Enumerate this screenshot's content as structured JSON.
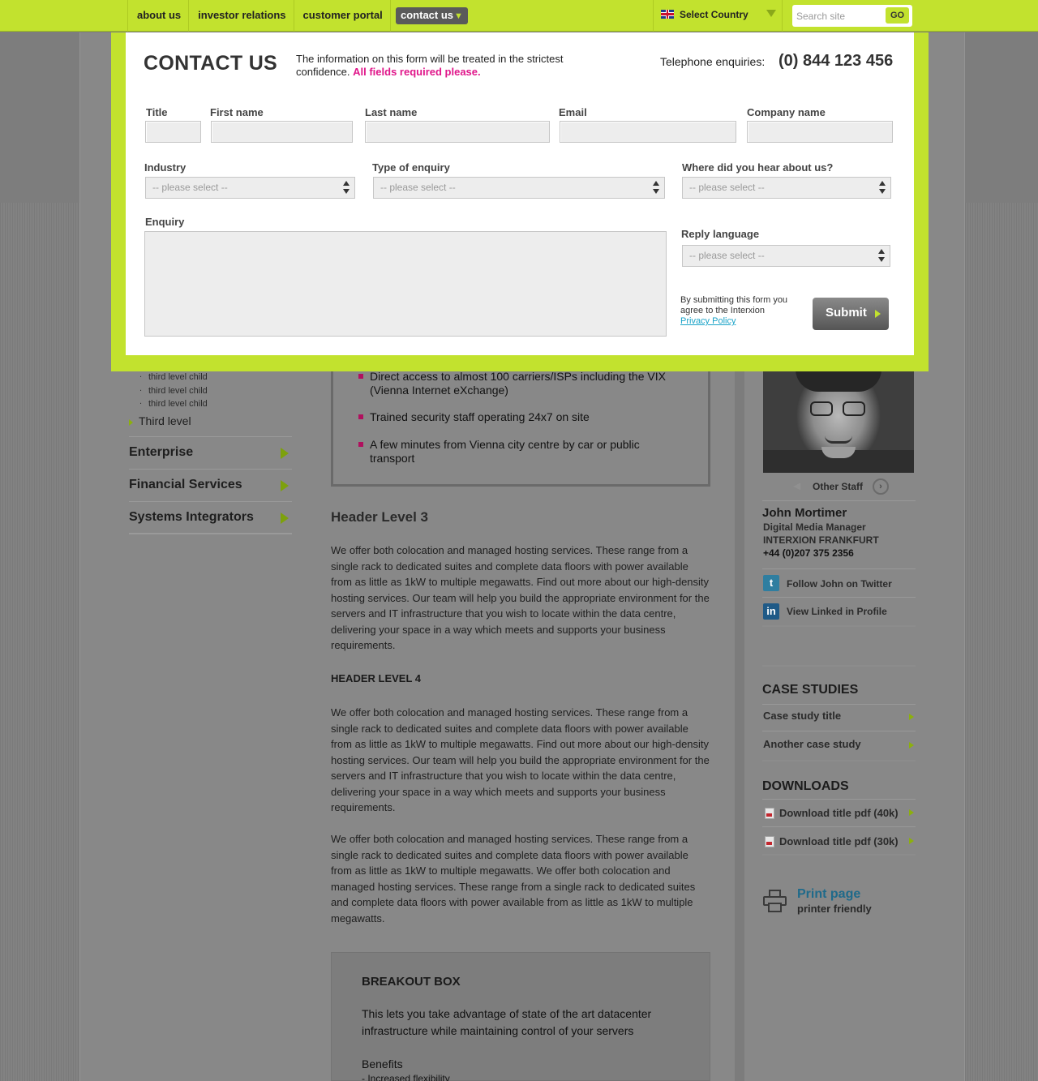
{
  "top_nav": {
    "items": [
      "about us",
      "investor relations",
      "customer portal"
    ],
    "contact": "contact us",
    "country": "Select Country",
    "search_placeholder": "Search site",
    "go": "GO"
  },
  "modal": {
    "title": "CONTACT US",
    "intro": "The information on this form will be treated in the strictest confidence.",
    "required": "All fields required please.",
    "tel_label": "Telephone enquiries:",
    "tel_number": "(0) 844 123 456",
    "fields": {
      "title": "Title",
      "first_name": "First name",
      "last_name": "Last name",
      "email": "Email",
      "company": "Company name",
      "industry": "Industry",
      "enquiry_type": "Type of enquiry",
      "heard": "Where did you hear about us?",
      "enquiry": "Enquiry",
      "reply_language": "Reply language"
    },
    "select_placeholder": "-- please select --",
    "agree_text": "By submitting this form you agree to the Interxion",
    "privacy_link": "Privacy Policy",
    "submit": "Submit"
  },
  "left_nav": {
    "children": [
      "third level child",
      "third level child",
      "third level child"
    ],
    "third_level": "Third level",
    "items": [
      "Enterprise",
      "Financial Services",
      "Systems Integrators"
    ]
  },
  "bullets": [
    "Direct access to almost 100 carriers/ISPs including the VIX (Vienna Internet eXchange)",
    "Trained security staff operating 24x7 on site",
    "A few minutes from Vienna city centre by car or public transport"
  ],
  "content": {
    "h3": "Header Level 3",
    "p1": "We offer both colocation and managed hosting services. These range from a single rack to dedicated suites and complete data floors with power available from as little as 1kW to multiple megawatts. Find out more about our high-density hosting services. Our team will help you build the appropriate environment for the servers and IT infrastructure that you wish to locate within the data centre, delivering your space in a way which meets and supports your business requirements.",
    "h4": "HEADER LEVEL 4",
    "p2": "We offer both colocation and managed hosting services. These range from a single rack to dedicated suites and complete data floors with power available from as little as 1kW to multiple megawatts. Find out more about our high-density hosting services. Our team will help you build the appropriate environment for the servers and IT infrastructure that you wish to locate within the data centre, delivering your space in a way which meets and supports your business requirements.",
    "p3": "We offer both colocation and managed hosting services. These range from a single rack to dedicated suites and complete data floors with power available from as little as 1kW to multiple megawatts. We offer both colocation and managed hosting services. These range from a single rack to dedicated suites and complete data floors with power available from as little as 1kW to multiple megawatts."
  },
  "breakout": {
    "title": "BREAKOUT BOX",
    "text": "This lets you take advantage of state of the art datacenter infrastructure while maintaining control of your servers",
    "benefits": "Benefits",
    "benefit_1": "- Increased flexibility"
  },
  "staff": {
    "other_staff": "Other Staff",
    "name": "John Mortimer",
    "role": "Digital Media Manager",
    "office": "INTERXION FRANKFURT",
    "phone": "+44 (0)207 375 2356",
    "twitter": "Follow John on Twitter",
    "linkedin": "View Linked in Profile"
  },
  "case_studies": {
    "heading": "CASE STUDIES",
    "items": [
      "Case study title",
      "Another case study"
    ]
  },
  "downloads": {
    "heading": "DOWNLOADS",
    "items": [
      "Download title pdf (40k)",
      "Download title pdf (30k)"
    ]
  },
  "print": {
    "title": "Print page",
    "sub": "printer friendly"
  },
  "colors": {
    "brand_green": "#c2e22e",
    "required_pink": "#e0168a",
    "link_blue": "#1aa3c8"
  }
}
